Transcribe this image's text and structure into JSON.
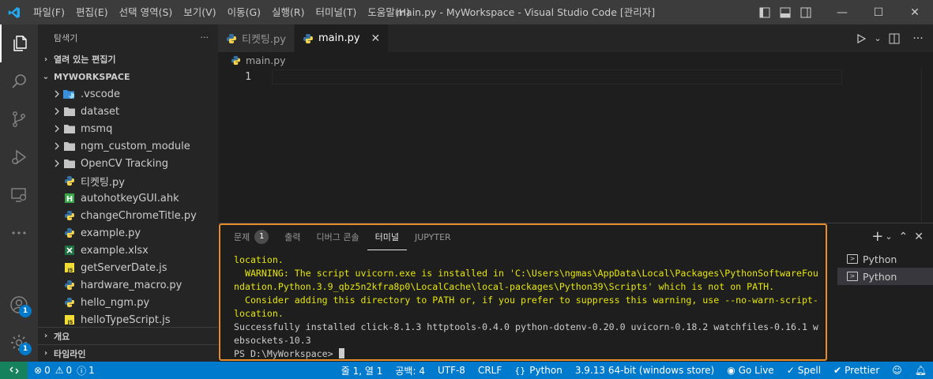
{
  "titlebar": {
    "menus": [
      "파일(F)",
      "편집(E)",
      "선택 영역(S)",
      "보기(V)",
      "이동(G)",
      "실행(R)",
      "터미널(T)",
      "도움말(H)"
    ],
    "title": "main.py - MyWorkspace - Visual Studio Code [관리자]",
    "minimize": "—",
    "maximize": "☐",
    "close": "✕"
  },
  "activity": {
    "account_badge": "1",
    "settings_badge": "1"
  },
  "sidebar": {
    "title": "탐색기",
    "more": "···",
    "open_editors": "열려 있는 편집기",
    "workspace": "MYWORKSPACE",
    "folders": [
      ".vscode",
      "dataset",
      "msmq",
      "ngm_custom_module",
      "OpenCV Tracking"
    ],
    "files": [
      "티켓팅.py",
      "autohotkeyGUI.ahk",
      "changeChromeTitle.py",
      "example.py",
      "example.xlsx",
      "getServerDate.js",
      "hardware_macro.py",
      "hello_ngm.py",
      "helloTypeScript.js"
    ],
    "outline": "개요",
    "timeline": "타임라인"
  },
  "tabs": [
    {
      "label": "티켓팅.py",
      "active": false
    },
    {
      "label": "main.py",
      "active": true
    }
  ],
  "tab_close": "✕",
  "editor": {
    "breadcrumb": "main.py",
    "line_number": "1"
  },
  "panel": {
    "tabs": [
      "문제",
      "출력",
      "디버그 콘솔",
      "터미널",
      "JUPYTER"
    ],
    "problems_count": "1",
    "terminal_lines": [
      {
        "text": "location.",
        "warn": true
      },
      {
        "text": "  WARNING: The script uvicorn.exe is installed in 'C:\\Users\\ngmas\\AppData\\Local\\Packages\\PythonSoftwareFou",
        "warn": true
      },
      {
        "text": "ndation.Python.3.9_qbz5n2kfra8p0\\LocalCache\\local-packages\\Python39\\Scripts' which is not on PATH.",
        "warn": true
      },
      {
        "text": "  Consider adding this directory to PATH or, if you prefer to suppress this warning, use --no-warn-script-",
        "warn": true
      },
      {
        "text": "location.",
        "warn": true
      },
      {
        "text": "Successfully installed click-8.1.3 httptools-0.4.0 python-dotenv-0.20.0 uvicorn-0.18.2 watchfiles-0.16.1 w",
        "warn": false
      },
      {
        "text": "ebsockets-10.3",
        "warn": false
      }
    ],
    "prompt": "PS D:\\MyWorkspace> ",
    "actions": {
      "add": "+",
      "dropdown": "⌄",
      "maximize": "⌃",
      "close": "✕"
    },
    "terminals": [
      "Python",
      "Python"
    ]
  },
  "statusbar": {
    "errors": "0",
    "warnings": "0",
    "info": "1",
    "position": "줄 1, 열 1",
    "spaces": "공백: 4",
    "encoding": "UTF-8",
    "eol": "CRLF",
    "language": "Python",
    "interpreter": "3.9.13 64-bit (windows store)",
    "golive": "Go Live",
    "spell": "Spell",
    "prettier": "Prettier"
  }
}
